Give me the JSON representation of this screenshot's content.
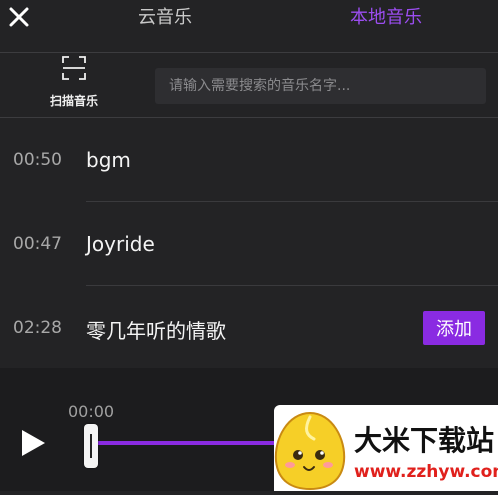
{
  "header": {
    "close_icon": "close-icon",
    "tabs": [
      {
        "label": "云音乐",
        "active": false
      },
      {
        "label": "本地音乐",
        "active": true
      }
    ]
  },
  "toolbar": {
    "scan_icon": "scan-icon",
    "scan_label": "扫描音乐",
    "search_placeholder": "请输入需要搜索的音乐名字..."
  },
  "songs": [
    {
      "duration": "00:50",
      "name": "bgm"
    },
    {
      "duration": "00:47",
      "name": "Joyride"
    },
    {
      "duration": "02:28",
      "name": "零几年听的情歌",
      "action": "添加"
    }
  ],
  "player": {
    "play_icon": "play-icon",
    "current_time": "00:00",
    "progress": 0
  },
  "watermark": {
    "text": "大米下载站",
    "url": "www.zzhyw.com"
  },
  "colors": {
    "accent": "#8a2be2",
    "active_tab": "#9b4df0",
    "background": "#232325"
  }
}
